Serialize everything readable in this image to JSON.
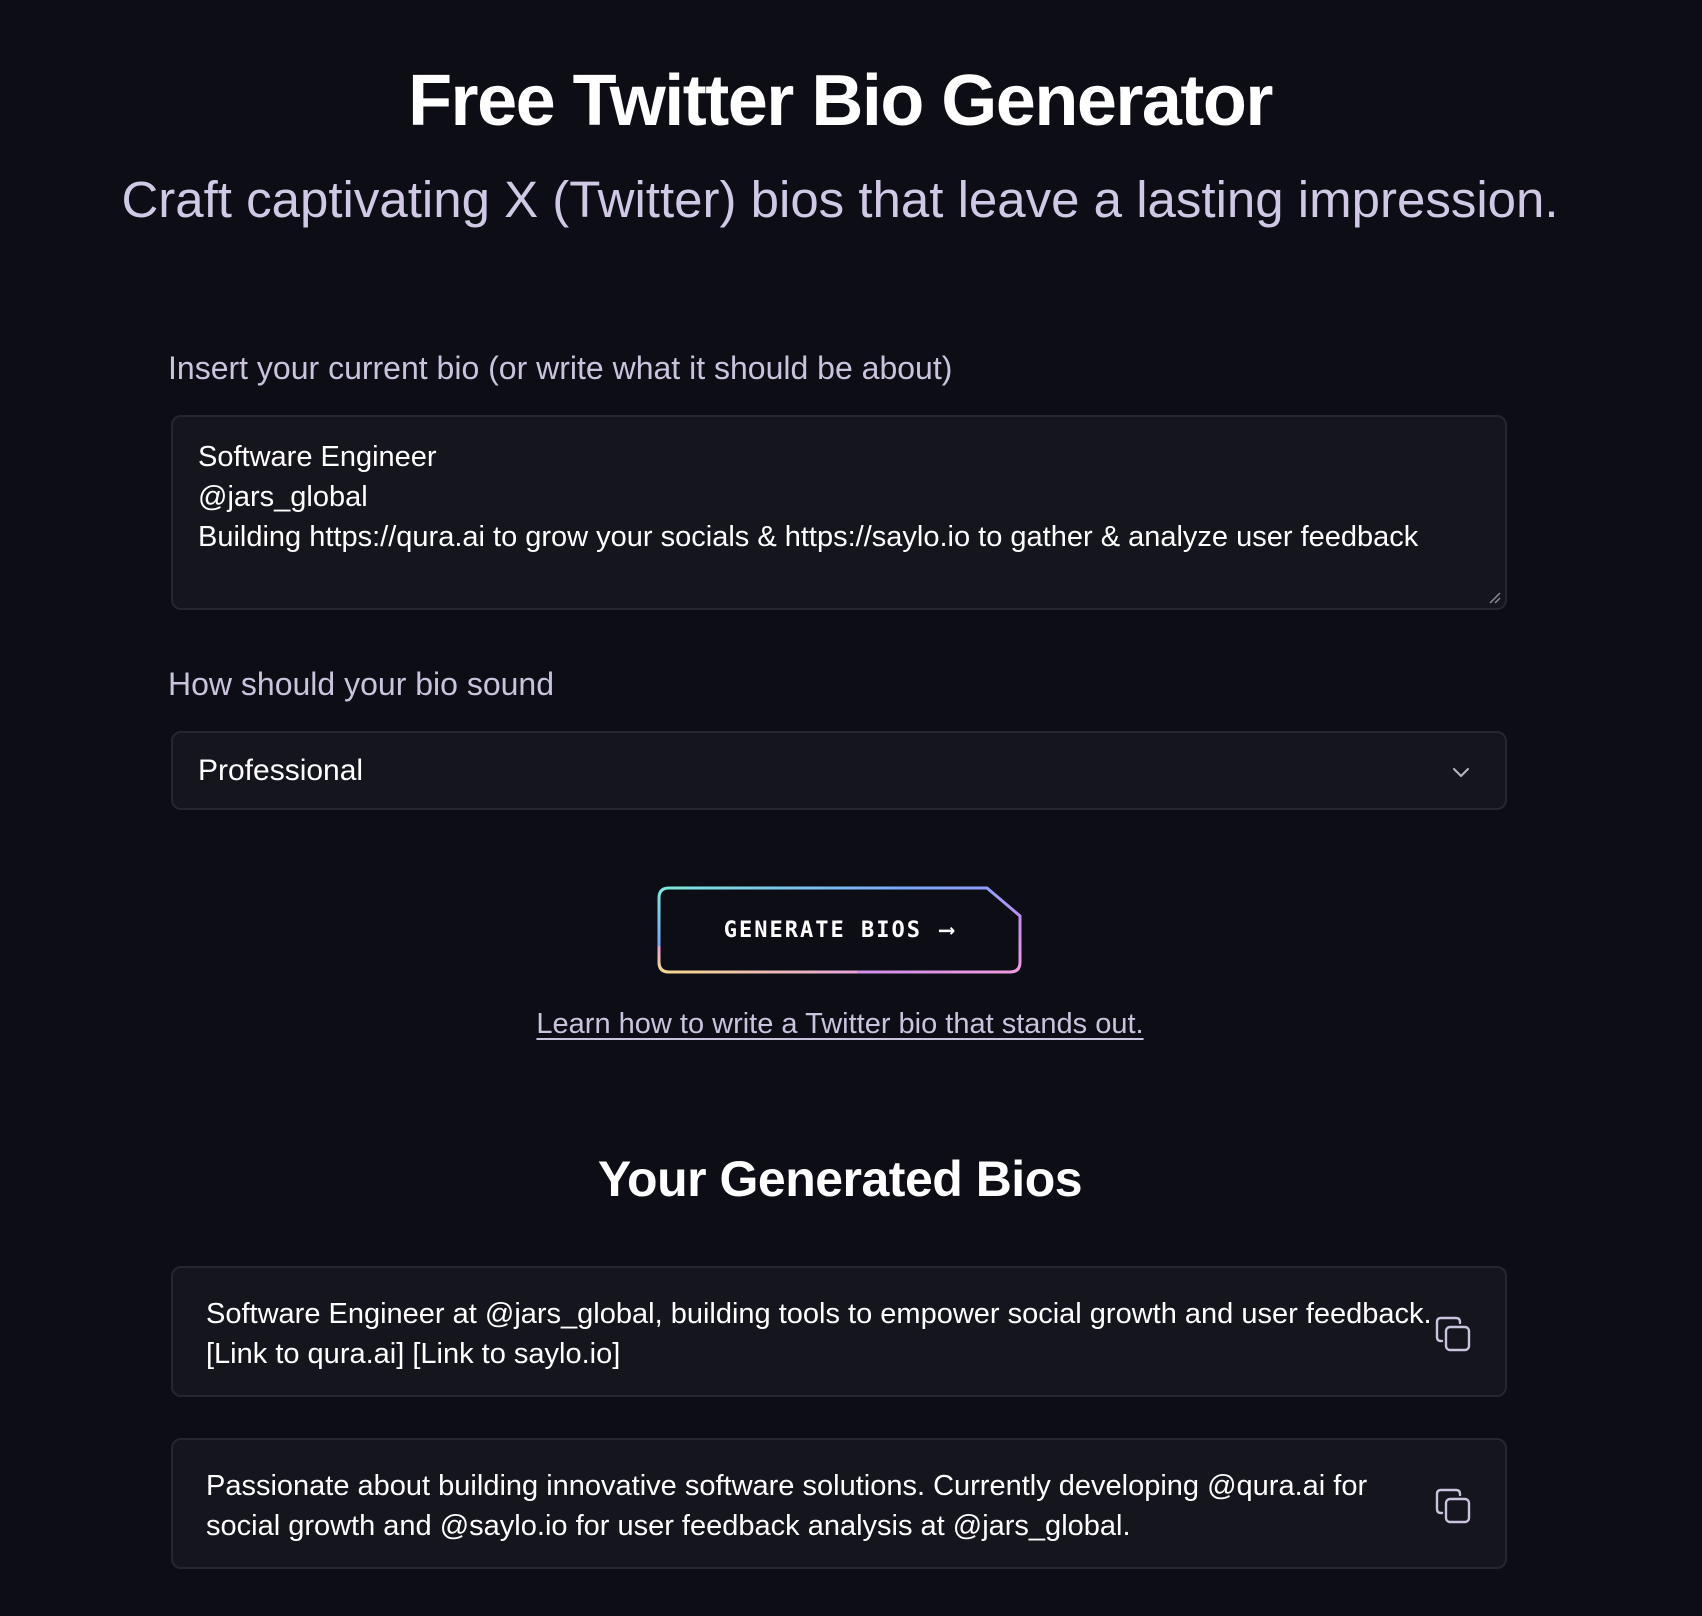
{
  "header": {
    "title": "Free Twitter Bio Generator",
    "subtitle": "Craft captivating X (Twitter) bios that leave a lasting impression."
  },
  "form": {
    "bio_label": "Insert your current bio (or write what it should be about)",
    "bio_value": "Software Engineer\n@jars_global\nBuilding https://qura.ai to grow your socials & https://saylo.io to gather & analyze user feedback",
    "tone_label": "How should your bio sound",
    "tone_selected": "Professional",
    "generate_label": "GENERATE BIOS",
    "generate_arrow": "⟶",
    "learn_link": "Learn how to write a Twitter bio that stands out."
  },
  "results": {
    "title": "Your Generated Bios",
    "bios": [
      {
        "text": "Software Engineer at @jars_global, building tools to empower social growth and user feedback. [Link to qura.ai] [Link to saylo.io]",
        "icon": "copy-icon"
      },
      {
        "text": "Passionate about building innovative software solutions. Currently developing @qura.ai for social growth and @saylo.io for user feedback analysis at @jars_global.",
        "icon": "copy-icon"
      }
    ]
  },
  "colors": {
    "background": "#0d0d15",
    "panel": "#15151e",
    "border": "#262631",
    "subtitle": "#cfc9e6",
    "gradient": [
      "#7ee8d9",
      "#7aa7ff",
      "#c58cf0",
      "#f4d98a"
    ]
  }
}
